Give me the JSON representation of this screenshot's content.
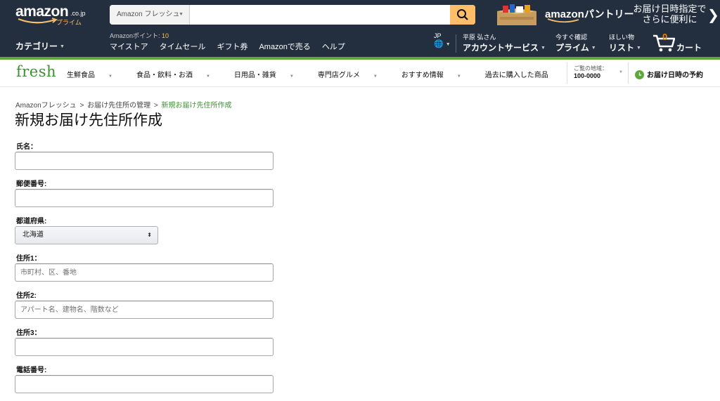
{
  "header": {
    "logo_word": "amazon",
    "logo_tld": ".co.jp",
    "logo_sub": "プライム",
    "search": {
      "department": "Amazon フレッシュ",
      "placeholder": ""
    },
    "promo_brand": "amazon",
    "promo_product": "パントリー",
    "delivery_promo_line1": "お届け日時指定で",
    "delivery_promo_line2": "さらに便利に",
    "delivery_promo_arrow": "❯",
    "category_label": "カテゴリー",
    "points_label": "Amazonポイント: ",
    "points_value": "10",
    "nav_links": [
      "マイストア",
      "タイムセール",
      "ギフト券",
      "Amazonで売る",
      "ヘルプ"
    ],
    "language": {
      "code": "JP",
      "globe": "🌐"
    },
    "account": {
      "greeting": "平原 弘さん",
      "label": "アカウントサービス"
    },
    "prime": {
      "small": "今すぐ確認",
      "label": "プライム"
    },
    "wishlist": {
      "small": "ほしい物",
      "label": "リスト"
    },
    "cart": {
      "count": "0",
      "label": "カート"
    }
  },
  "fresh_nav": {
    "logo": "fresh",
    "items": [
      "生鮮食品",
      "食品・飲料・お酒",
      "日用品・雑貨",
      "専門店グルメ",
      "おすすめ情報",
      "過去に購入した商品"
    ],
    "region_label": "ご覧の地域：",
    "region_value": "100-0000",
    "reserve_label": "お届け日時の予約"
  },
  "breadcrumb": {
    "items": [
      "Amazonフレッシュ",
      "お届け先住所の管理",
      "新規お届け先住所作成"
    ],
    "separator": ">"
  },
  "page_title": "新規お届け先住所作成",
  "form": {
    "name_label": "氏名：",
    "name_value": "",
    "postal_label": "郵便番号:",
    "postal_value": "",
    "prefecture_label": "都道府県:",
    "prefecture_value": "北海道",
    "address1_label": "住所1：",
    "address1_placeholder": "市町村、区、番地",
    "address2_label": "住所2:",
    "address2_placeholder": "アパート名、建物名、階数など",
    "address3_label": "住所3：",
    "address3_value": "",
    "phone_label": "電話番号:",
    "phone_value": ""
  },
  "colors": {
    "header_bg": "#232f3e",
    "accent_orange": "#febd69",
    "fresh_green": "#5ea83a",
    "breadcrumb_current": "#3d8f33"
  }
}
